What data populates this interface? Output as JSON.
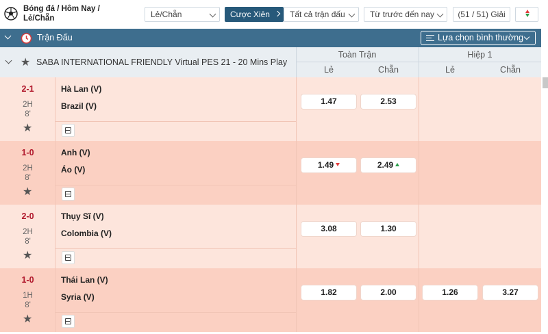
{
  "breadcrumb": "Bóng đá / Hôm Nay / Lẻ/Chẵn",
  "filters": {
    "bet_type": "Lẻ/Chẵn",
    "parlay": "Cược Xiên",
    "matches": "Tất cả trận đấu",
    "sort": "Từ trước đến nay",
    "leagues": "(51 / 51) Giải"
  },
  "section": {
    "title": "Trận Đấu",
    "sort_option": "Lựa chọn bình thường"
  },
  "league": {
    "name": "SABA INTERNATIONAL FRIENDLY Virtual PES 21 - 20 Mins Play",
    "full_time": "Toàn Trận",
    "first_half": "Hiệp 1",
    "odd": "Lẻ",
    "even": "Chẵn"
  },
  "matches": [
    {
      "score": "2-1",
      "period": "2H",
      "minute": "8'",
      "home": "Hà Lan (V)",
      "away": "Brazil (V)",
      "ft_odd": "1.47",
      "ft_even": "2.53",
      "h1_odd": "",
      "h1_even": ""
    },
    {
      "score": "1-0",
      "period": "2H",
      "minute": "8'",
      "home": "Anh (V)",
      "away": "Áo (V)",
      "ft_odd": "1.49",
      "ft_even": "2.49",
      "ft_odd_trend": "down",
      "ft_even_trend": "up",
      "h1_odd": "",
      "h1_even": ""
    },
    {
      "score": "2-0",
      "period": "2H",
      "minute": "8'",
      "home": "Thụy Sĩ (V)",
      "away": "Colombia (V)",
      "ft_odd": "3.08",
      "ft_even": "1.30",
      "h1_odd": "",
      "h1_even": ""
    },
    {
      "score": "1-0",
      "period": "1H",
      "minute": "8'",
      "home": "Thái Lan (V)",
      "away": "Syria (V)",
      "ft_odd": "1.82",
      "ft_even": "2.00",
      "h1_odd": "1.26",
      "h1_even": "3.27"
    }
  ],
  "colors": {
    "header_blue": "#3e6e8e",
    "parlay_blue": "#27597a",
    "row_light": "#fde5dc",
    "row_dark": "#fbd0c2",
    "score_red": "#b0162a"
  }
}
